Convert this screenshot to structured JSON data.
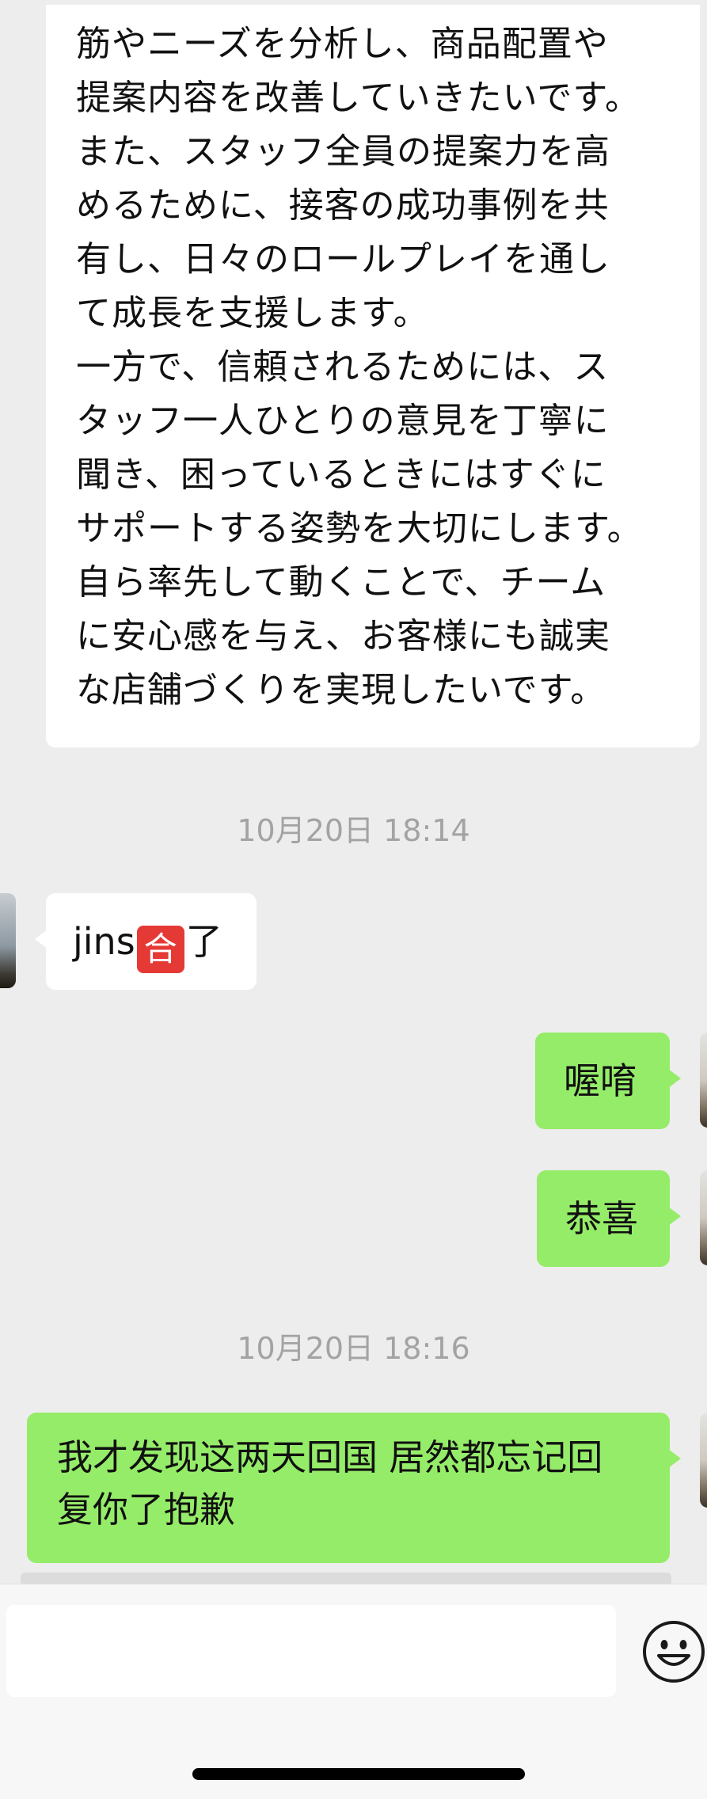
{
  "messages": {
    "long_received": {
      "text": "筋やニーズを分析し、商品配置や\n提案内容を改善していきたいです。\nまた、スタッフ全員の提案力を高\nめるために、接客の成功事例を共\n有し、日々のロールプレイを通し\nて成長を支援します。\n一方で、信頼されるためには、ス\nタッフ一人ひとりの意見を丁寧に\n聞き、困っているときにはすぐに\nサポートする姿勢を大切にします。\n自ら率先して動くことで、チーム\nに安心感を与え、お客様にも誠実\nな店舗づくりを実現したいです。"
    },
    "timestamp_1": "10月20日 18:14",
    "jins_msg": {
      "prefix": "jins",
      "emoji": "🈴",
      "emoji_glyph": "合",
      "suffix": "了"
    },
    "reply_1": "喔唷",
    "reply_2": "恭喜",
    "timestamp_2": "10月20日 18:16",
    "reply_3": "我才发现这两天回国 居然都忘记回\n复你了抱歉"
  },
  "input": {
    "value": "",
    "placeholder": ""
  },
  "icons": {
    "emoji_button": "smiley-face-icon"
  },
  "colors": {
    "background": "#ededed",
    "incoming_bubble": "#ffffff",
    "outgoing_bubble": "#95ec69",
    "timestamp": "#a3a3a3"
  }
}
